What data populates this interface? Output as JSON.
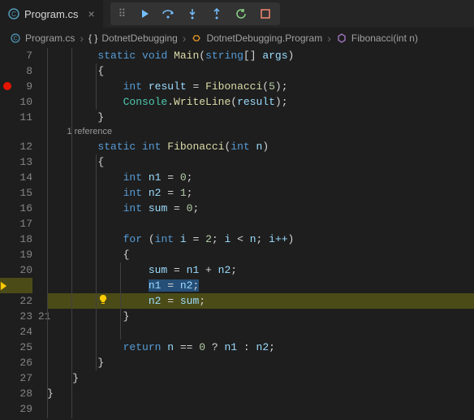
{
  "tab": {
    "filename": "Program.cs",
    "close": "×"
  },
  "debugToolbar": {
    "grip": "⠿"
  },
  "breadcrumbs": {
    "file": "Program.cs",
    "namespace": "DotnetDebugging",
    "class": "DotnetDebugging.Program",
    "method": "Fibonacci(int n)"
  },
  "codelens": {
    "references": "1 reference"
  },
  "lineNumbers": [
    "7",
    "8",
    "9",
    "10",
    "11",
    "12",
    "13",
    "14",
    "15",
    "16",
    "17",
    "18",
    "19",
    "20",
    "21",
    "22",
    "23",
    "24",
    "25",
    "26",
    "27",
    "28",
    "29"
  ],
  "code": {
    "l7": {
      "kw1": "static",
      "kw2": "void",
      "fn": "Main",
      "t1": "string",
      "p": "args"
    },
    "l8": "{",
    "l9": {
      "t": "int",
      "v": "result",
      "fn": "Fibonacci",
      "n": "5"
    },
    "l10": {
      "c": "Console",
      "m": "WriteLine",
      "a": "result"
    },
    "l11": "}",
    "l12": {
      "kw1": "static",
      "kw2": "int",
      "fn": "Fibonacci",
      "t": "int",
      "p": "n"
    },
    "l13": "{",
    "l14": {
      "t": "int",
      "v": "n1",
      "n": "0"
    },
    "l15": {
      "t": "int",
      "v": "n2",
      "n": "1"
    },
    "l16": {
      "t": "int",
      "v": "sum",
      "n": "0"
    },
    "l18": {
      "kw": "for",
      "t": "int",
      "v": "i",
      "n1": "2",
      "c": "i < n",
      "inc": "i++"
    },
    "l19": "{",
    "l20": {
      "v1": "sum",
      "v2": "n1",
      "v3": "n2"
    },
    "l21": {
      "v1": "n1",
      "v2": "n2"
    },
    "l22": {
      "v1": "n2",
      "v2": "sum"
    },
    "l23": "}",
    "l25": {
      "kw": "return",
      "v": "n",
      "n": "0",
      "v1": "n1",
      "v2": "n2"
    },
    "l26": "}",
    "l27": "}",
    "l28": "}"
  },
  "breakpointLine": 9,
  "executionLine": 21
}
